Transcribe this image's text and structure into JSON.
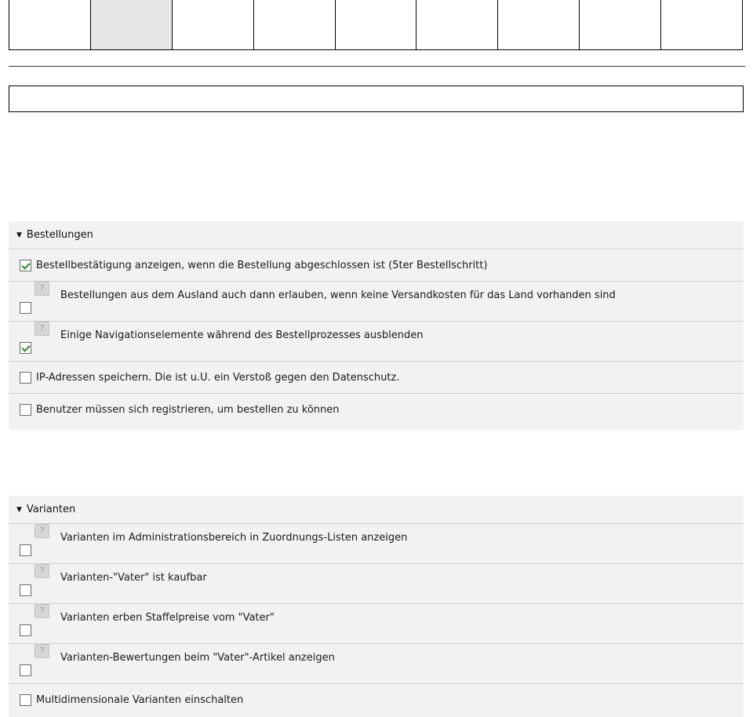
{
  "tabs": [
    {
      "active": false
    },
    {
      "active": true
    },
    {
      "active": false
    },
    {
      "active": false
    },
    {
      "active": false
    },
    {
      "active": false
    },
    {
      "active": false
    },
    {
      "active": false
    },
    {
      "active": false
    }
  ],
  "sections": [
    {
      "title": "Bestellungen",
      "rows": [
        {
          "label": "Bestellbestätigung anzeigen, wenn die Bestellung abgeschlossen ist (5ter Bestellschritt)",
          "checked": true,
          "help": false
        },
        {
          "label": "Bestellungen aus dem Ausland auch dann erlauben, wenn keine Versandkosten für das Land vorhanden sind",
          "checked": false,
          "help": true
        },
        {
          "label": "Einige Navigationselemente während des Bestellprozesses ausblenden",
          "checked": true,
          "help": true
        },
        {
          "label": "IP-Adressen speichern. Die ist u.U. ein Verstoß gegen den Datenschutz.",
          "checked": false,
          "help": false
        },
        {
          "label": "Benutzer müssen sich registrieren, um bestellen zu können",
          "checked": false,
          "help": false
        }
      ]
    },
    {
      "title": "Varianten",
      "rows": [
        {
          "label": "Varianten im Administrationsbereich in Zuordnungs-Listen anzeigen",
          "checked": false,
          "help": true
        },
        {
          "label": "Varianten-\"Vater\" ist kaufbar",
          "checked": false,
          "help": true
        },
        {
          "label": "Varianten erben Staffelpreise vom \"Vater\"",
          "checked": false,
          "help": true
        },
        {
          "label": "Varianten-Bewertungen beim \"Vater\"-Artikel anzeigen",
          "checked": false,
          "help": true
        },
        {
          "label": "Multidimensionale Varianten einschalten",
          "checked": false,
          "help": false
        }
      ]
    }
  ],
  "icons": {
    "help": "?",
    "caret": "▼"
  },
  "colors": {
    "section_bg": "#f2f2f2",
    "active_tab_bg": "#e6e6e6",
    "check_green": "#2a8a2a"
  }
}
